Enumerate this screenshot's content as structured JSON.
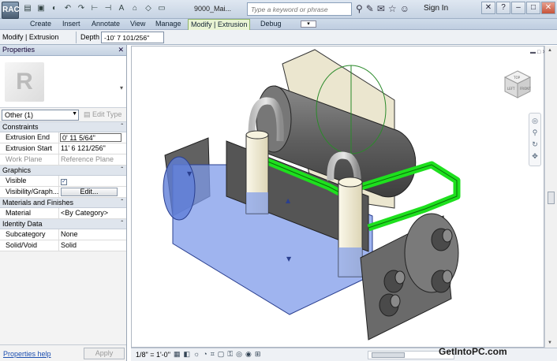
{
  "titlebar": {
    "app_button": "RAC",
    "doc_title": "9000_Mai...",
    "search_placeholder": "Type a keyword or phrase",
    "sign_in": "Sign In"
  },
  "ribbon": {
    "tabs": [
      "Create",
      "Insert",
      "Annotate",
      "View",
      "Manage",
      "Modify | Extrusion",
      "Debug"
    ],
    "active_tab": "Modify | Extrusion"
  },
  "options_bar": {
    "context": "Modify | Extrusion",
    "depth_label": "Depth",
    "depth_value": "-10'  7 101/256\""
  },
  "properties": {
    "title": "Properties",
    "filter_value": "Other (1)",
    "edit_type": "Edit Type",
    "groups": {
      "constraints": "Constraints",
      "graphics": "Graphics",
      "materials": "Materials and Finishes",
      "identity": "Identity Data"
    },
    "rows": {
      "extrusion_end": {
        "label": "Extrusion End",
        "value": "0'  11 5/64\""
      },
      "extrusion_start": {
        "label": "Extrusion Start",
        "value": "11'  6 121/256\""
      },
      "work_plane": {
        "label": "Work Plane",
        "value": "Reference Plane"
      },
      "visible": {
        "label": "Visible",
        "value": "✓"
      },
      "visibility": {
        "label": "Visibility/Graph...",
        "value": "Edit..."
      },
      "material": {
        "label": "Material",
        "value": "<By Category>"
      },
      "subcategory": {
        "label": "Subcategory",
        "value": "None"
      },
      "solid_void": {
        "label": "Solid/Void",
        "value": "Solid"
      }
    },
    "help_link": "Properties help",
    "apply": "Apply"
  },
  "viewport": {
    "viewcube_faces": [
      "TOP",
      "LEFT",
      "FRONT"
    ]
  },
  "viewbar": {
    "scale": "1/8\" = 1'-0\""
  },
  "watermark": "GetIntoPC.com",
  "colors": {
    "blue_extrusion": "#7f9bea",
    "pipe_green": "#1ee01e",
    "body_grey": "#6e6e6e",
    "riser_cream": "#f4efd7"
  }
}
